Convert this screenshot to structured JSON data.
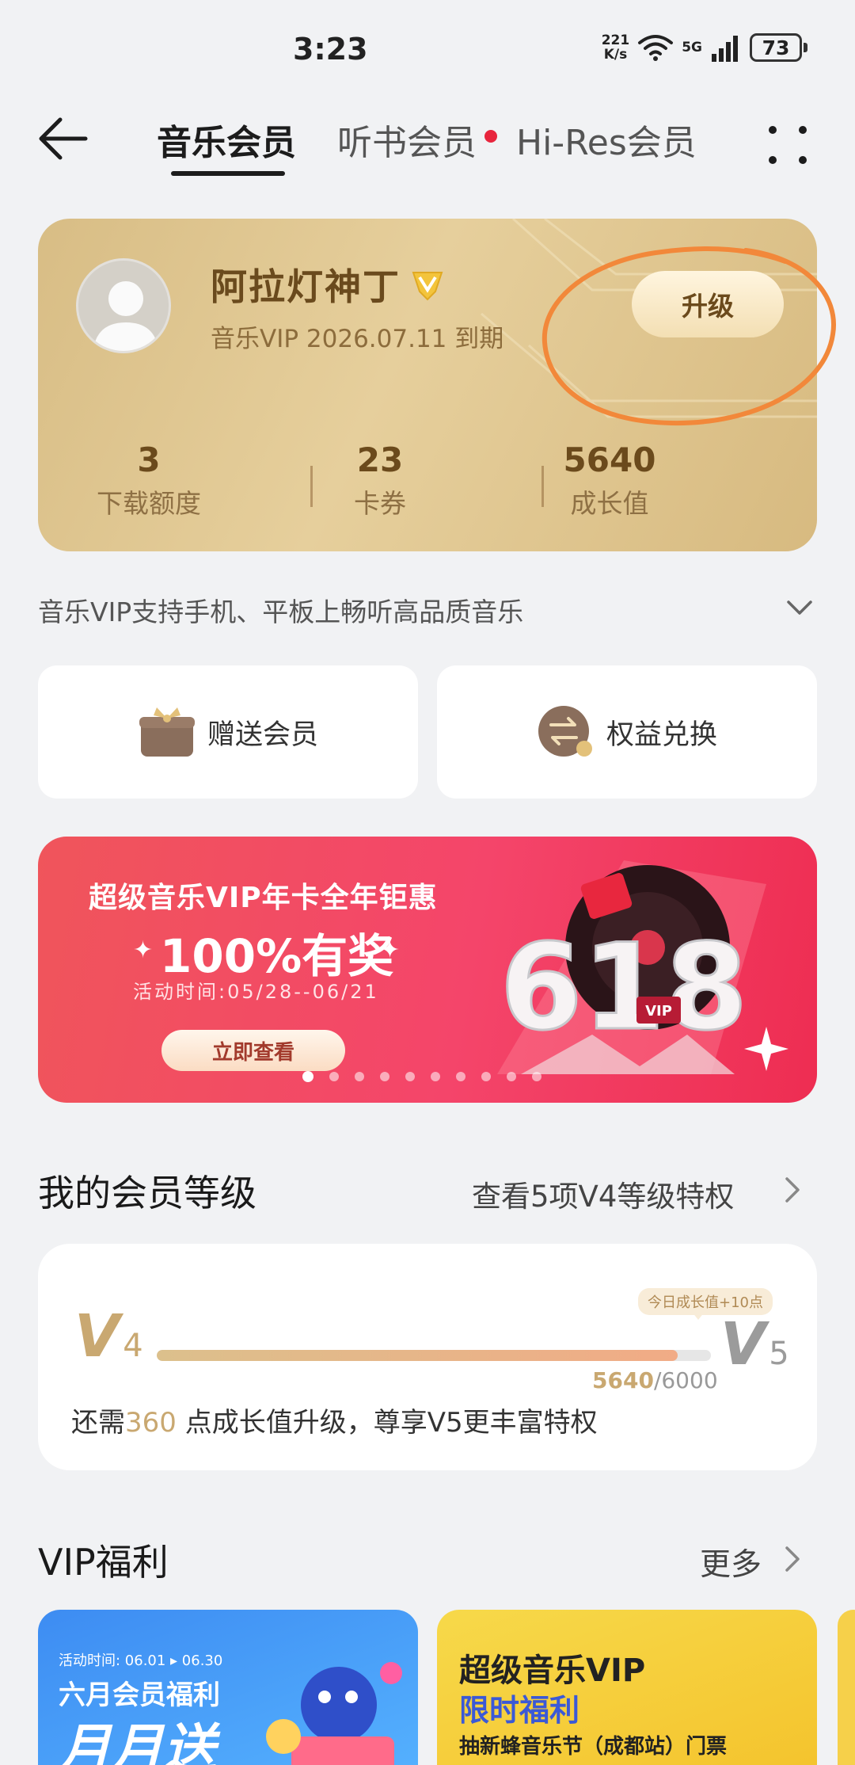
{
  "status_bar": {
    "time": "3:23",
    "net_speed_value": "221",
    "net_speed_unit": "K/s",
    "network_type": "5G",
    "battery": "73"
  },
  "tabs": [
    {
      "label": "音乐会员",
      "active": true
    },
    {
      "label": "听书会员",
      "has_dot": true
    },
    {
      "label": "Hi-Res会员"
    }
  ],
  "member": {
    "name": "阿拉灯神丁",
    "vip_badge_level": "V4",
    "expiry": "音乐VIP 2026.07.11 到期",
    "upgrade_label": "升级",
    "stats": [
      {
        "value": "3",
        "label": "下载额度"
      },
      {
        "value": "23",
        "label": "卡券"
      },
      {
        "value": "5640",
        "label": "成长值"
      }
    ]
  },
  "vip_desc": "音乐VIP支持手机、平板上畅听高品质音乐",
  "actions": {
    "gift": {
      "label": "赠送会员",
      "icon": "gift-icon"
    },
    "exchange": {
      "label": "权益兑换",
      "icon": "exchange-icon"
    }
  },
  "banner": {
    "title": "超级音乐VIP年卡全年钜惠",
    "headline": "100%有奖",
    "time": "活动时间:05/28--06/21",
    "cta": "立即查看",
    "art_text": "618",
    "art_badge": "VIP",
    "dot_count": 10,
    "active_dot": 0
  },
  "level": {
    "title": "我的会员等级",
    "link": "查看5项V4等级特权",
    "current_letter": "V",
    "current_num": "4",
    "next_letter": "V",
    "next_num": "5",
    "today_tip": "今日成长值+10点",
    "progress_current": "5640",
    "progress_total": "/6000",
    "progress_fraction": 0.94,
    "need_prefix": "还需",
    "need_num": "360",
    "need_suffix": " 点成长值升级，尊享V5更丰富特权"
  },
  "welfare": {
    "title": "VIP福利",
    "more": "更多",
    "card1": {
      "time": "活动时间: 06.01 ▸ 06.30",
      "title": "六月会员福利",
      "big": "月月送"
    },
    "card2": {
      "title": "超级音乐VIP",
      "subtitle": "限时福利",
      "desc": "抽新蜂音乐节（成都站）门票"
    }
  },
  "colors": {
    "gold_card": "#d8bd85",
    "gold_text": "#c9a871",
    "banner_red": "#f4456a",
    "annotation": "#f2883a"
  }
}
